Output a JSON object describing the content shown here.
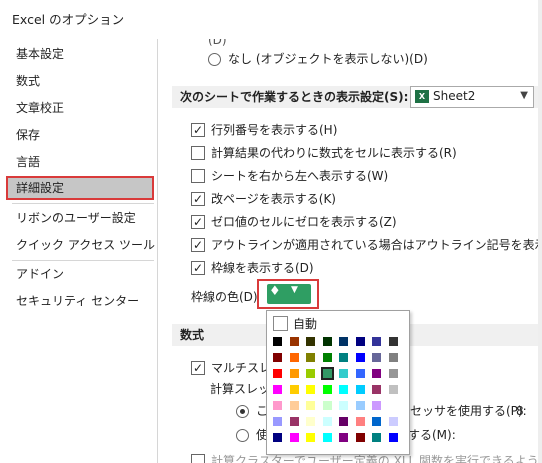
{
  "window": {
    "title": "Excel のオプション"
  },
  "sidebar": {
    "items": [
      {
        "label": "基本設定"
      },
      {
        "label": "数式"
      },
      {
        "label": "文章校正"
      },
      {
        "label": "保存"
      },
      {
        "label": "言語"
      },
      {
        "label": "詳細設定"
      },
      {
        "label": "リボンのユーザー設定"
      },
      {
        "label": "クイック アクセス ツール バー"
      },
      {
        "label": "アドイン"
      },
      {
        "label": "セキュリティ センター"
      }
    ],
    "selected": "詳細設定"
  },
  "main": {
    "partial_top": "(D)",
    "none_option": "なし (オブジェクトを表示しない)(D)",
    "sheet_section": "次のシートで作業するときの表示設定(S):",
    "sheet_combo": "Sheet2",
    "options": [
      {
        "label": "行列番号を表示する(H)",
        "checked": true
      },
      {
        "label": "計算結果の代わりに数式をセルに表示する(R)",
        "checked": false
      },
      {
        "label": "シートを右から左へ表示する(W)",
        "checked": false
      },
      {
        "label": "改ページを表示する(K)",
        "checked": true
      },
      {
        "label": "ゼロ値のセルにゼロを表示する(Z)",
        "checked": true
      },
      {
        "label": "アウトラインが適用されている場合はアウトライン記号を表示する(O)",
        "checked": true
      },
      {
        "label": "枠線を表示する(D)",
        "checked": true
      }
    ],
    "gridline_color_label": "枠線の色(D)",
    "formula_section": "数式",
    "multithread": "マルチスレッ",
    "calc_thread": "計算スレッド",
    "radio1": "こ",
    "radio1_tail": "セッサを使用する(P):",
    "radio1_value": "8",
    "radio2": "使",
    "radio2_tail": "する(M):",
    "spin_value": "8",
    "bottom_partial": "計算クラスターでユーザー定義の XLL 関数を実行できるようにする(U)"
  },
  "palette": {
    "auto_label": "自動",
    "colors": [
      [
        "#000000",
        "#993300",
        "#333300",
        "#003300",
        "#003366",
        "#000080",
        "#333399",
        "#333333"
      ],
      [
        "#800000",
        "#FF6600",
        "#808000",
        "#008000",
        "#008080",
        "#0000FF",
        "#666699",
        "#808080"
      ],
      [
        "#FF0000",
        "#FF9900",
        "#99CC00",
        "#339966",
        "#33CCCC",
        "#3366FF",
        "#800080",
        "#969696"
      ],
      [
        "#FF00FF",
        "#FFCC00",
        "#FFFF00",
        "#00FF00",
        "#00FFFF",
        "#00CCFF",
        "#993366",
        "#C0C0C0"
      ],
      [
        "#FF99CC",
        "#FFCC99",
        "#FFFF99",
        "#CCFFCC",
        "#CCFFFF",
        "#99CCFF",
        "#CC99FF",
        "#FFFFFF"
      ],
      [
        "#9999FF",
        "#993366",
        "#FFFFCC",
        "#CCFFFF",
        "#660066",
        "#FF8080",
        "#0066CC",
        "#CCCCFF"
      ],
      [
        "#000080",
        "#FF00FF",
        "#FFFF00",
        "#00FFFF",
        "#800080",
        "#800000",
        "#008080",
        "#0000FF"
      ]
    ],
    "selected_row": 2,
    "selected_col": 3,
    "accent": "#2f9e63"
  }
}
